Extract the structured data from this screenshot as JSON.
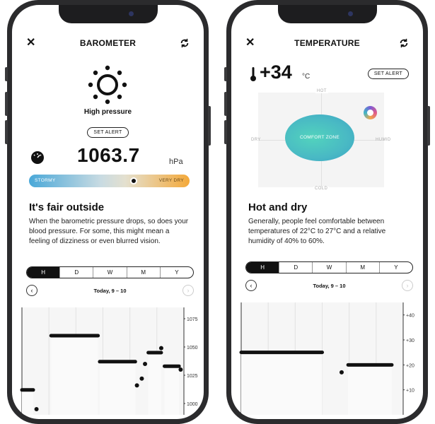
{
  "left": {
    "title": "BAROMETER",
    "icon_close": "close-icon",
    "icon_sync": "sync-icon",
    "condition": "High pressure",
    "set_alert": "SET ALERT",
    "reading": "1063.7",
    "unit": "hPa",
    "scale_left": "STORMY",
    "scale_right": "VERY DRY",
    "scale_position": 0.65,
    "heading": "It's fair outside",
    "description": "When the barometric pressure drops, so does your blood pressure. For some, this might mean a feeling of dizziness or even blurred vision.",
    "tabs": [
      "H",
      "D",
      "W",
      "M",
      "Y"
    ],
    "active_tab": 0,
    "date_label": "Today, 9 – 10",
    "chart_data": {
      "type": "line",
      "y_ticks": [
        "1075",
        "1050",
        "1025",
        "1000"
      ],
      "ylim": [
        990,
        1085
      ],
      "segments": [
        {
          "x": [
            0.0,
            0.07
          ],
          "y": 1012
        },
        {
          "x": [
            0.18,
            0.47
          ],
          "y": 1060
        },
        {
          "x": [
            0.48,
            0.7
          ],
          "y": 1037
        },
        {
          "x": [
            0.78,
            0.86
          ],
          "y": 1045
        },
        {
          "x": [
            0.88,
            0.97
          ],
          "y": 1033
        }
      ],
      "points": [
        {
          "x": 0.09,
          "y": 995
        },
        {
          "x": 0.71,
          "y": 1016
        },
        {
          "x": 0.74,
          "y": 1022
        },
        {
          "x": 0.76,
          "y": 1035
        },
        {
          "x": 0.86,
          "y": 1049
        },
        {
          "x": 0.98,
          "y": 1030
        }
      ]
    }
  },
  "right": {
    "title": "TEMPERATURE",
    "icon_close": "close-icon",
    "icon_sync": "sync-icon",
    "reading": "+34",
    "unit": "°C",
    "set_alert": "SET ALERT",
    "matrix": {
      "top": "HOT",
      "bottom": "COLD",
      "left": "DRY",
      "right": "HUMID",
      "zone": "COMFORT ZONE"
    },
    "heading": "Hot and dry",
    "description": "Generally, people feel comfortable between temperatures of 22°C to 27°C and a relative humidity of 40% to 60%.",
    "tabs": [
      "H",
      "D",
      "W",
      "M",
      "Y"
    ],
    "active_tab": 0,
    "date_label": "Today, 9 – 10",
    "chart_data": {
      "type": "line",
      "y_ticks": [
        "+40",
        "+30",
        "+20",
        "+10"
      ],
      "ylim": [
        0,
        45
      ],
      "segments": [
        {
          "x": [
            0.0,
            0.5
          ],
          "y": 25
        },
        {
          "x": [
            0.66,
            0.93
          ],
          "y": 20
        }
      ],
      "points": [
        {
          "x": 0.62,
          "y": 17
        }
      ]
    }
  },
  "colors": {
    "stormy": "#4aa8d8",
    "very_dry": "#f4a93a",
    "comfort": "#52d3bd"
  }
}
